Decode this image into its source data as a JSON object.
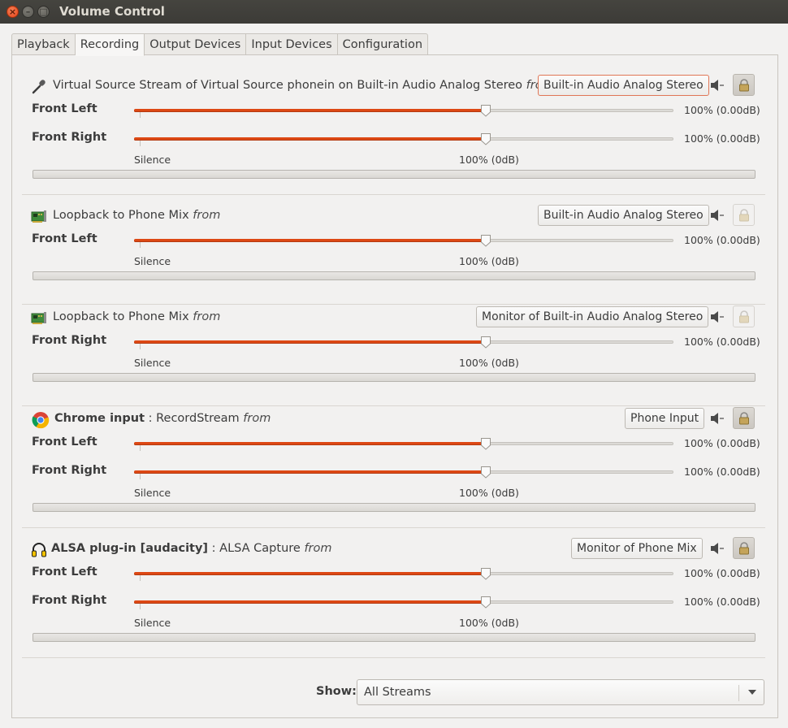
{
  "window": {
    "title": "Volume Control",
    "close_glyph": "×",
    "min_glyph": "–",
    "max_glyph": "□"
  },
  "tabs": [
    {
      "label": "Playback",
      "active": false
    },
    {
      "label": "Recording",
      "active": true
    },
    {
      "label": "Output Devices",
      "active": false
    },
    {
      "label": "Input Devices",
      "active": false
    },
    {
      "label": "Configuration",
      "active": false
    }
  ],
  "scale": {
    "silence_label": "Silence",
    "normal_label": "100% (0dB)"
  },
  "streams": [
    {
      "icon": "microphone-icon",
      "app": "",
      "name": "Virtual Source Stream of Virtual Source phonein on Built-in Audio Analog Stereo",
      "from_label": "from",
      "device": "Built-in Audio Analog Stereo",
      "locked": true,
      "channels": [
        {
          "label": "Front Left",
          "value": "100% (0.00dB)",
          "level": 1.0
        },
        {
          "label": "Front Right",
          "value": "100% (0.00dB)",
          "level": 1.0
        }
      ]
    },
    {
      "icon": "sound-card-icon",
      "app": "",
      "name": "Loopback to Phone Mix",
      "from_label": "from",
      "device": "Built-in Audio Analog Stereo",
      "locked": false,
      "channels": [
        {
          "label": "Front Left",
          "value": "100% (0.00dB)",
          "level": 1.0
        }
      ]
    },
    {
      "icon": "sound-card-icon",
      "app": "",
      "name": "Loopback to Phone Mix",
      "from_label": "from",
      "device": "Monitor of Built-in Audio Analog Stereo",
      "locked": false,
      "channels": [
        {
          "label": "Front Right",
          "value": "100% (0.00dB)",
          "level": 1.0
        }
      ]
    },
    {
      "icon": "chrome-icon",
      "app": "Chrome input",
      "name": "RecordStream",
      "from_label": "from",
      "device": "Phone Input",
      "locked": true,
      "channels": [
        {
          "label": "Front Left",
          "value": "100% (0.00dB)",
          "level": 1.0
        },
        {
          "label": "Front Right",
          "value": "100% (0.00dB)",
          "level": 1.0
        }
      ]
    },
    {
      "icon": "headphones-icon",
      "app": "ALSA plug-in [audacity]",
      "name": "ALSA Capture",
      "from_label": "from",
      "device": "Monitor of Phone Mix",
      "locked": true,
      "channels": [
        {
          "label": "Front Left",
          "value": "100% (0.00dB)",
          "level": 1.0
        },
        {
          "label": "Front Right",
          "value": "100% (0.00dB)",
          "level": 1.0
        }
      ]
    }
  ],
  "show": {
    "label": "Show:",
    "value": "All Streams"
  }
}
